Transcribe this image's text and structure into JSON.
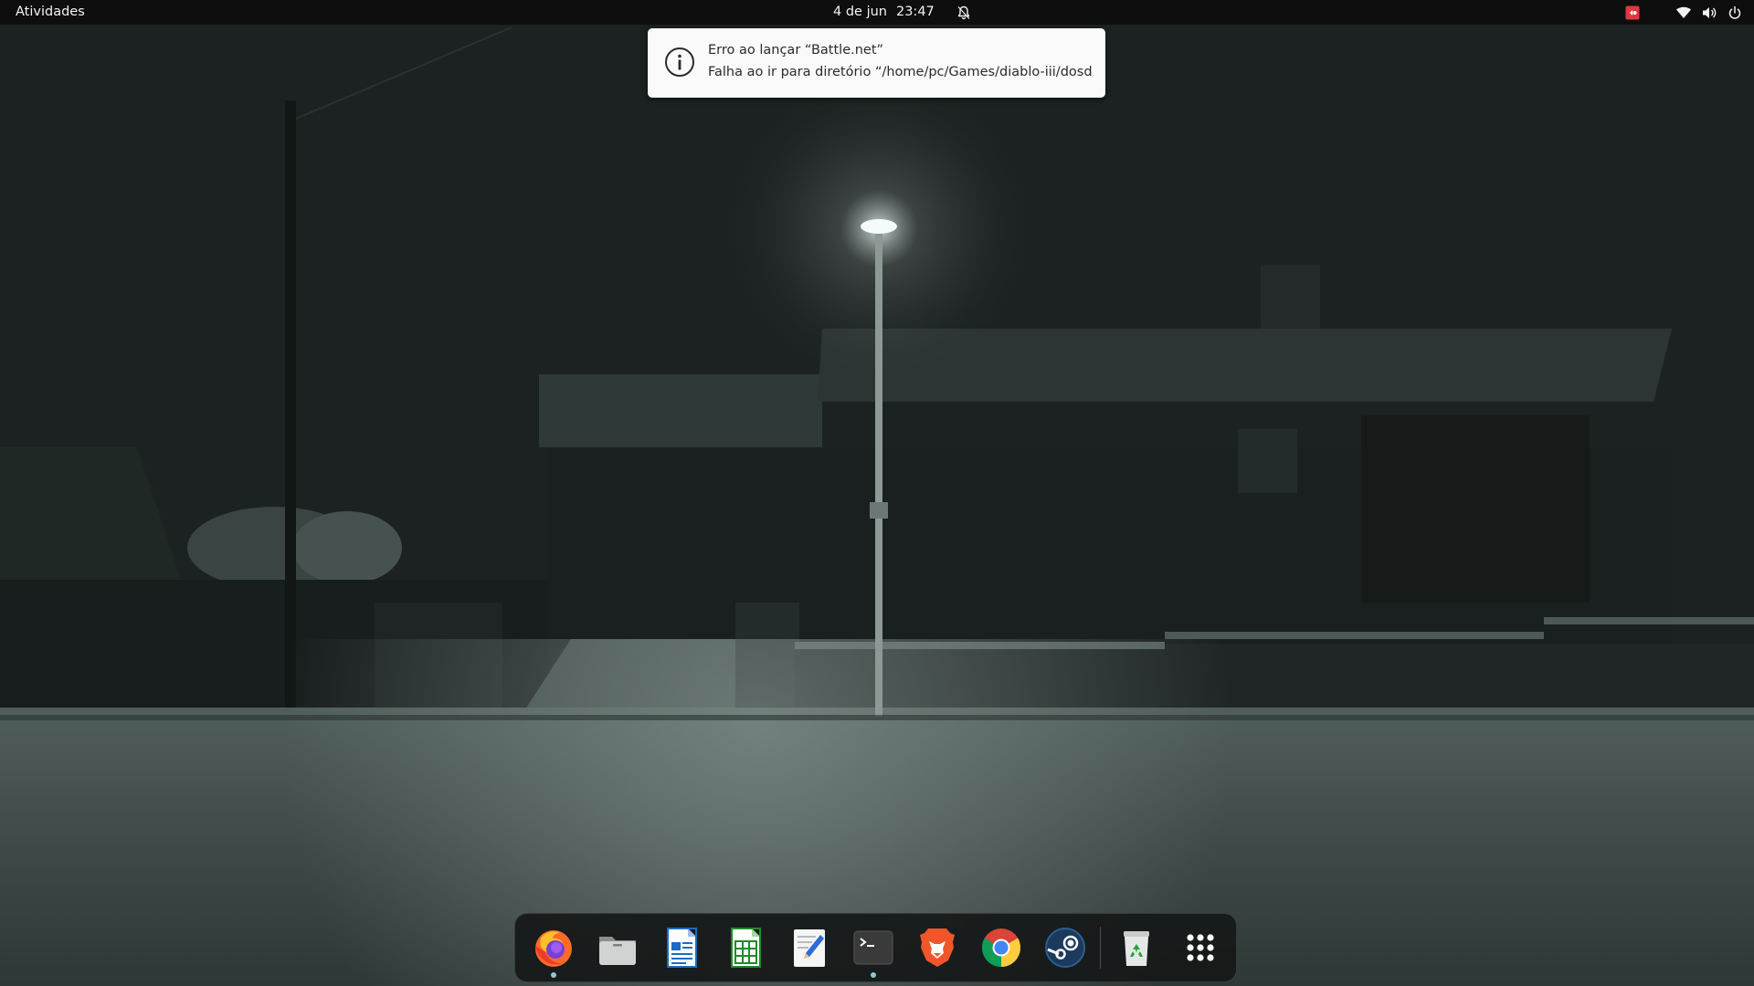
{
  "topbar": {
    "activities_label": "Atividades",
    "date": "4 de jun",
    "time": "23:47"
  },
  "notification": {
    "title": "Erro ao lançar “Battle.net”",
    "body": "Falha ao ir para diretório “/home/pc/Games/diablo-iii/dosde…"
  },
  "dock": {
    "items": [
      {
        "name": "firefox",
        "running": true
      },
      {
        "name": "files",
        "running": false
      },
      {
        "name": "libreoffice-writer",
        "running": false
      },
      {
        "name": "libreoffice-calc",
        "running": false
      },
      {
        "name": "text-editor",
        "running": false
      },
      {
        "name": "terminal",
        "running": true
      },
      {
        "name": "brave",
        "running": false
      },
      {
        "name": "chrome",
        "running": false
      },
      {
        "name": "steam",
        "running": false
      },
      {
        "name": "trash",
        "running": false
      },
      {
        "name": "show-applications",
        "running": false
      }
    ]
  },
  "colors": {
    "topbar": "#0e0e0e",
    "notification_bg": "#fafafa",
    "running_indicator": "#8fc9d6",
    "record_indicator": "#e0383e"
  }
}
